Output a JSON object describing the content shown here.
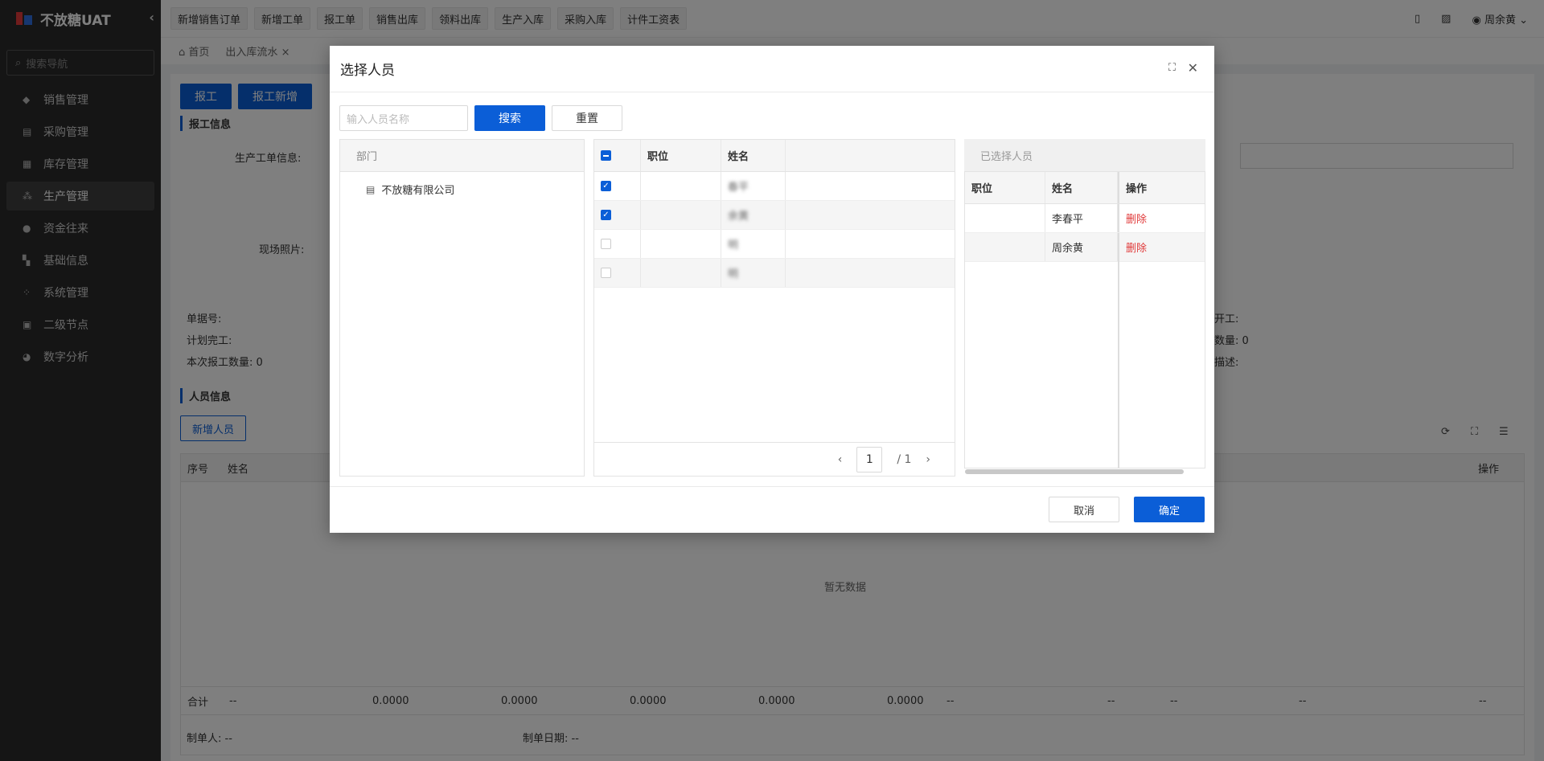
{
  "app": {
    "title": "不放糖UAT"
  },
  "sidebar": {
    "search_placeholder": "搜索导航",
    "items": [
      {
        "label": "销售管理",
        "icon": "tag-icon"
      },
      {
        "label": "采购管理",
        "icon": "cart-icon"
      },
      {
        "label": "库存管理",
        "icon": "warehouse-icon"
      },
      {
        "label": "生产管理",
        "icon": "production-icon"
      },
      {
        "label": "资金往来",
        "icon": "money-icon"
      },
      {
        "label": "基础信息",
        "icon": "grid-icon"
      },
      {
        "label": "系统管理",
        "icon": "settings-grid-icon"
      },
      {
        "label": "二级节点",
        "icon": "doc-icon"
      },
      {
        "label": "数字分析",
        "icon": "pie-icon"
      }
    ]
  },
  "topbar": {
    "quick_buttons": [
      "新增销售订单",
      "新增工单",
      "报工单",
      "销售出库",
      "领料出库",
      "生产入库",
      "采购入库",
      "计件工资表"
    ],
    "user": "周余黄"
  },
  "tabs": [
    "首页",
    "出入库流水"
  ],
  "main": {
    "btn_report": "报工",
    "btn_report_add": "报工新增",
    "section_report": "报工信息",
    "label_order_info": "生产工单信息:",
    "label_photos": "现场照片:",
    "label_doc_no": "单据号:",
    "label_plan_finish": "计划完工:",
    "label_report_qty": "本次报工数量: 0",
    "label_right1": "开工:",
    "label_right2": "数量: 0",
    "label_right3": "描述:",
    "section_people": "人员信息",
    "btn_add_person": "新增人员",
    "col_seq": "序号",
    "col_name": "姓名",
    "col_op": "操作",
    "empty": "暂无数据",
    "sum_label": "合计",
    "sum_values": [
      "--",
      "0.0000",
      "0.0000",
      "0.0000",
      "0.0000",
      "0.0000",
      "--",
      "--",
      "--",
      "--",
      "--"
    ],
    "footer_maker": "制单人: --",
    "footer_date": "制单日期: --"
  },
  "modal": {
    "title": "选择人员",
    "search_placeholder": "输入人员名称",
    "btn_search": "搜索",
    "btn_reset": "重置",
    "dept_header": "部门",
    "dept_node": "不放糖有限公司",
    "grid_headers": {
      "position": "职位",
      "name": "姓名"
    },
    "grid_rows": [
      {
        "checked": true,
        "position": "",
        "name": "春平"
      },
      {
        "checked": true,
        "position": "",
        "name": "余黄"
      },
      {
        "checked": false,
        "position": "",
        "name": "明"
      },
      {
        "checked": false,
        "position": "",
        "name": "明"
      }
    ],
    "pager": {
      "page": "1",
      "total": "/ 1"
    },
    "selected_header": "已选择人员",
    "selected_cols": {
      "position": "职位",
      "name": "姓名",
      "op": "操作"
    },
    "selected_rows": [
      {
        "position": "",
        "name": "李春平",
        "op": "删除"
      },
      {
        "position": "",
        "name": "周余黄",
        "op": "删除"
      }
    ],
    "btn_cancel": "取消",
    "btn_ok": "确定"
  }
}
